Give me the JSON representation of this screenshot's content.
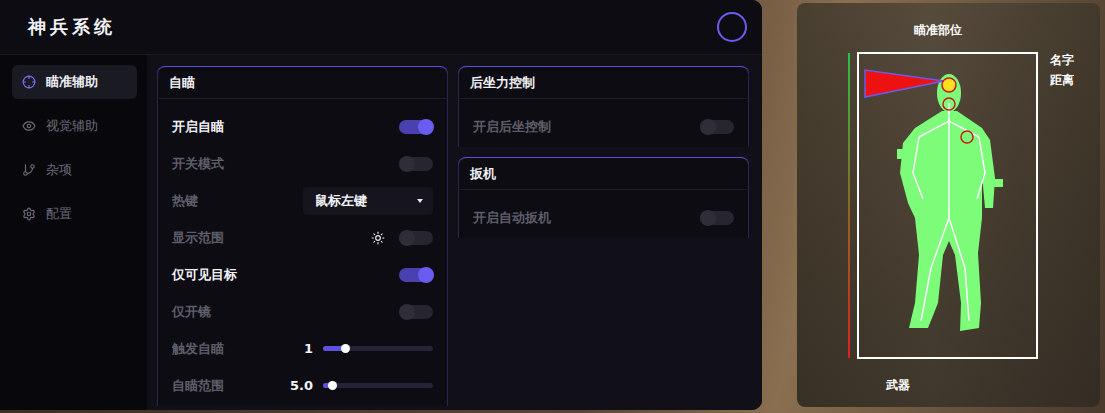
{
  "window": {
    "title": "神兵系统"
  },
  "sidebar": {
    "items": [
      {
        "label": "瞄准辅助",
        "selected": true
      },
      {
        "label": "视觉辅助",
        "selected": false
      },
      {
        "label": "杂项",
        "selected": false
      },
      {
        "label": "配置",
        "selected": false
      }
    ]
  },
  "columns": [
    [
      {
        "title": "自瞄",
        "rows": [
          {
            "kind": "toggle",
            "label": "开启自瞄",
            "on": true
          },
          {
            "kind": "toggle",
            "label": "开关模式",
            "on": false
          },
          {
            "kind": "select",
            "label": "热键",
            "value": "鼠标左键"
          },
          {
            "kind": "icon-toggle",
            "label": "显示范围",
            "on": false
          },
          {
            "kind": "toggle",
            "label": "仅可见目标",
            "on": true
          },
          {
            "kind": "toggle",
            "label": "仅开镜",
            "on": false
          },
          {
            "kind": "slider",
            "label": "触发自瞄",
            "value": "1",
            "level": 0.2
          },
          {
            "kind": "slider",
            "label": "自瞄范围",
            "value": "5.0",
            "level": 0.08
          }
        ]
      }
    ],
    [
      {
        "title": "后坐力控制",
        "rows": [
          {
            "kind": "toggle",
            "label": "开启后坐控制",
            "on": false
          }
        ]
      },
      {
        "title": "扳机",
        "rows": [
          {
            "kind": "toggle",
            "label": "开启自动扳机",
            "on": false
          }
        ]
      }
    ]
  ],
  "preview": {
    "aim_part_label": "瞄准部位",
    "name_label": "名字",
    "distance_label": "距离",
    "weapon_label": "武器",
    "health": {
      "level": 1
    },
    "aim_points": [
      {
        "selected": true
      },
      {
        "selected": false
      },
      {
        "selected": false
      }
    ]
  }
}
